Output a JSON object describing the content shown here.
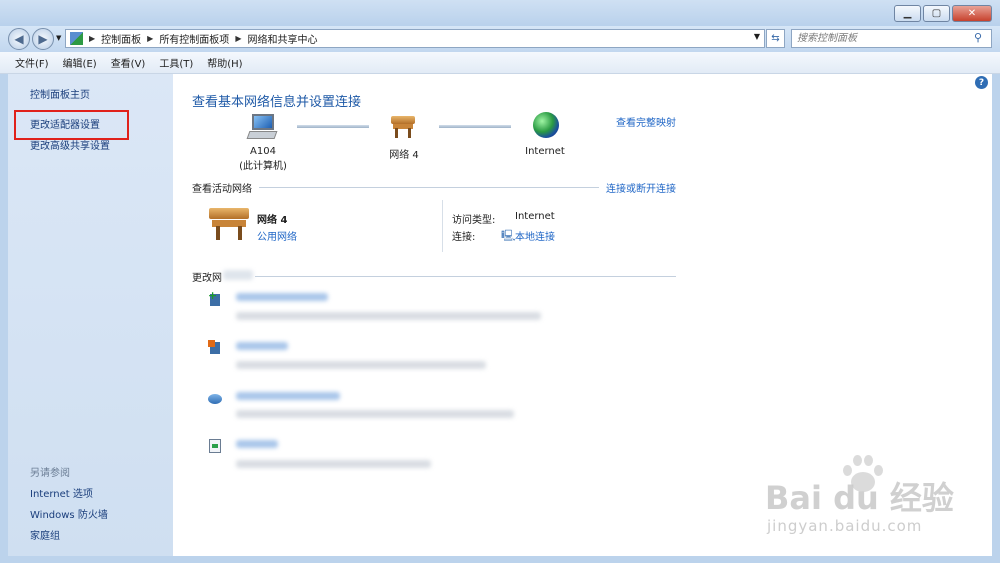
{
  "address": {
    "segments": [
      "控制面板",
      "所有控制面板项",
      "网络和共享中心"
    ],
    "search_placeholder": "搜索控制面板"
  },
  "menu": [
    "文件(F)",
    "编辑(E)",
    "查看(V)",
    "工具(T)",
    "帮助(H)"
  ],
  "sidebar": {
    "links": [
      "控制面板主页",
      "更改适配器设置",
      "更改高级共享设置"
    ],
    "see_also_heading": "另请参阅",
    "see_also": [
      "Internet 选项",
      "Windows 防火墙",
      "家庭组"
    ]
  },
  "main": {
    "title": "查看基本网络信息并设置连接",
    "full_map_link": "查看完整映射",
    "nodes": {
      "computer_name": "A104",
      "computer_sub": "(此计算机)",
      "network": "网络  4",
      "internet": "Internet"
    },
    "active_networks_label": "查看活动网络",
    "connect_disconnect_link": "连接或断开连接",
    "network_name": "网络  4",
    "network_type": "公用网络",
    "access_type_label": "访问类型:",
    "access_type_value": "Internet",
    "connection_label": "连接:",
    "connection_value": "本地连接",
    "change_settings_label": "更改网"
  },
  "watermark": {
    "logo": "Bai du 经验",
    "url": "jingyan.baidu.com"
  },
  "colors": {
    "link": "#1f66c6",
    "title": "#1f5aa7",
    "sidebar_bg": "#d6e4f5",
    "highlight": "#e0211b"
  }
}
